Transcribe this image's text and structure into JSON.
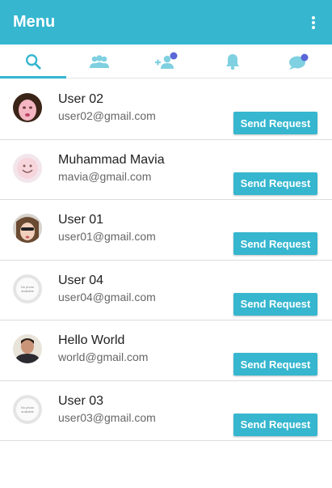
{
  "appbar": {
    "title": "Menu",
    "menu_icon": "more-vert-icon"
  },
  "theme": {
    "primary": "#36b6cf",
    "tab_inactive": "#7fd0e0"
  },
  "tabs": [
    {
      "icon": "search-icon",
      "active": true
    },
    {
      "icon": "group-icon",
      "active": false
    },
    {
      "icon": "add-friend-icon",
      "active": false
    },
    {
      "icon": "bell-icon",
      "active": false
    },
    {
      "icon": "chat-icon",
      "active": false
    }
  ],
  "users": [
    {
      "name": "User 02",
      "email": "user02@gmail.com",
      "button": "Send Request",
      "avatar": "photo-girl-pink"
    },
    {
      "name": "Muhammad Mavia",
      "email": "mavia@gmail.com",
      "button": "Send Request",
      "avatar": "photo-smiley-ball"
    },
    {
      "name": "User 01",
      "email": "user01@gmail.com",
      "button": "Send Request",
      "avatar": "photo-girl-sunglasses"
    },
    {
      "name": "User 04",
      "email": "user04@gmail.com",
      "button": "Send Request",
      "avatar": "no-photo",
      "avatar_text": "No photo available"
    },
    {
      "name": "Hello World",
      "email": "world@gmail.com",
      "button": "Send Request",
      "avatar": "photo-man"
    },
    {
      "name": "User 03",
      "email": "user03@gmail.com",
      "button": "Send Request",
      "avatar": "no-photo",
      "avatar_text": "No photo available"
    }
  ]
}
